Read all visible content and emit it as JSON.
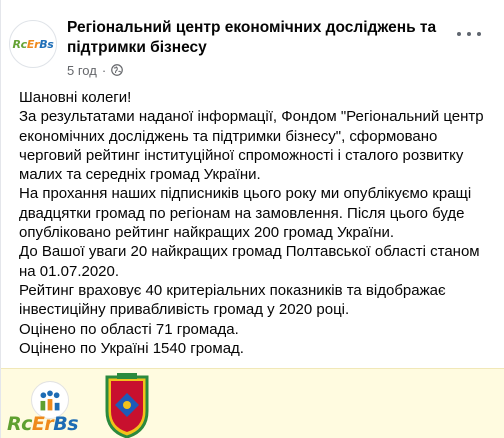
{
  "post": {
    "avatar_text": [
      "Rc",
      "Er",
      "Bs"
    ],
    "page_name": "Регіональний центр економічних досліджень та підтримки бізнесу",
    "time": "5 год",
    "privacy_icon": "globe-icon",
    "more_icon": "more-horizontal-icon",
    "paragraphs": [
      "Шановні колеги!",
      "За результатами наданої інформації, Фондом \"Регіональний центр економічних досліджень та підтримки бізнесу\", сформовано черговий рейтинг інституційної спроможності і сталого розвитку малих та середніх громад України.",
      "На прохання наших підписників цього року ми опублікуємо кращі двадцятки громад по регіонам на замовлення. Після цього буде опубліковано рейтинг найкращих 200 громад України.",
      "До Вашої уваги 20 найкращих громад  Полтавської області станом на 01.07.2020.",
      "Рейтинг враховує 40 критеріальних показників та відображає інвестиційну привабливість громад у 2020 році.",
      "Оцінено по області 71 громада.",
      "Оцінено по Україні 1540 громад."
    ]
  },
  "image": {
    "logo_text": [
      "Rc",
      "Er",
      "Bs"
    ],
    "logo_icon": "people-chart-icon",
    "emblem": "coat-of-arms-icon"
  },
  "colors": {
    "brand_green": "#5fa030",
    "brand_orange": "#ef8a1c",
    "brand_blue": "#1e6cb4",
    "strip_background": "#fffbe0"
  }
}
